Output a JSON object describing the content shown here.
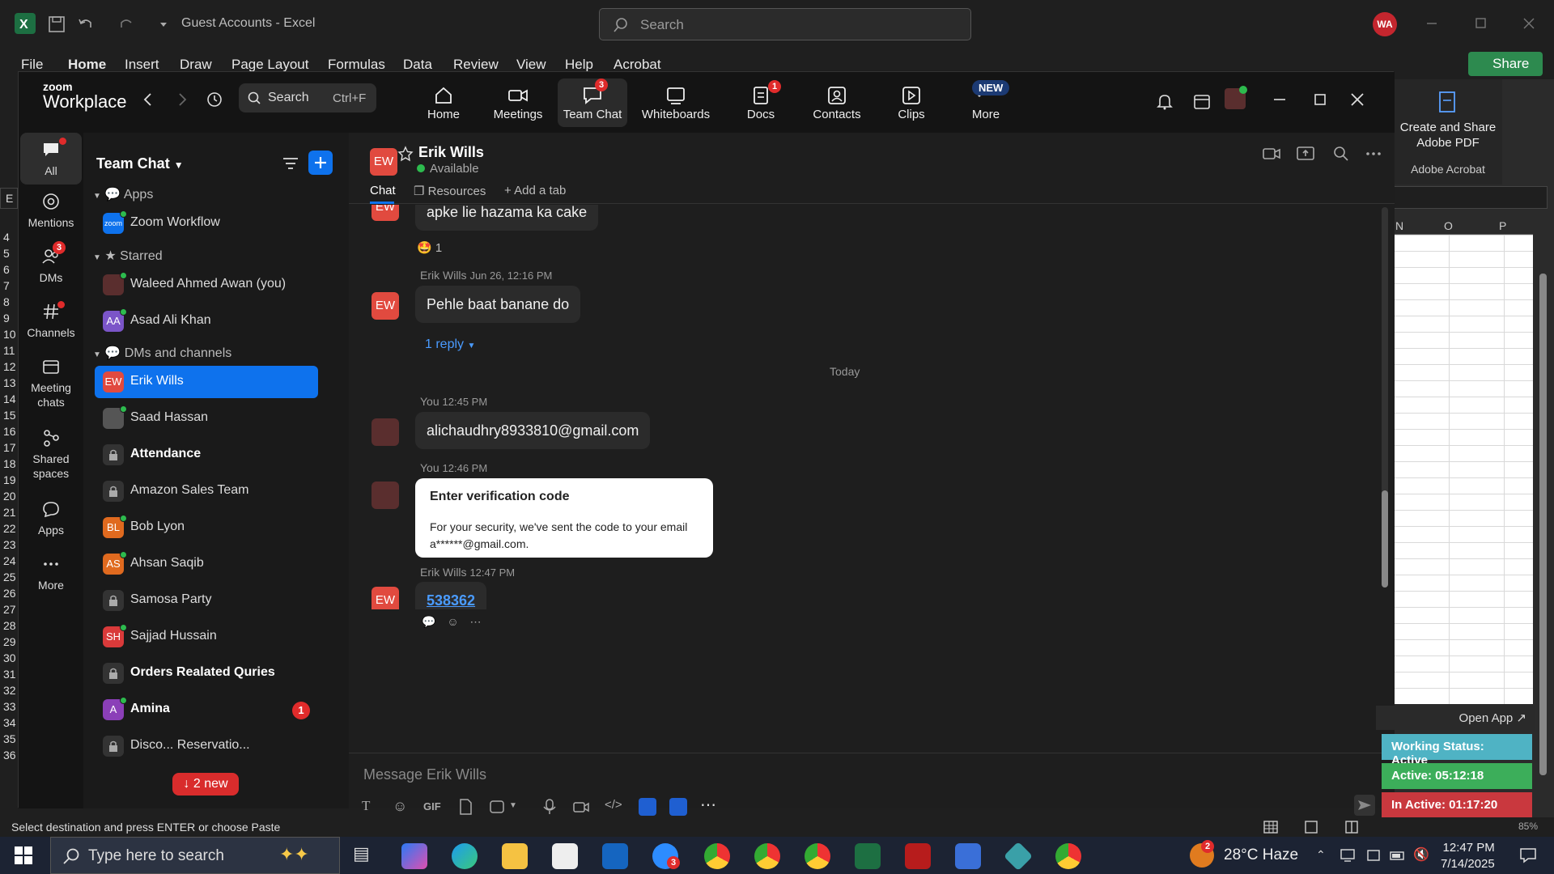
{
  "excel": {
    "title": "Guest Accounts  -  Excel",
    "search_placeholder": "Search",
    "avatar": "WA",
    "menu": [
      "File",
      "Home",
      "Insert",
      "Draw",
      "Page Layout",
      "Formulas",
      "Data",
      "Review",
      "View",
      "Help",
      "Acrobat"
    ],
    "share": "Share",
    "acrobat_label": "Create and Share Adobe PDF",
    "acrobat_group": "Adobe Acrobat",
    "columns": [
      "N",
      "O",
      "P"
    ],
    "rows": [
      "4",
      "5",
      "6",
      "7",
      "8",
      "9",
      "10",
      "11",
      "12",
      "13",
      "14",
      "15",
      "16",
      "17",
      "18",
      "19",
      "20",
      "21",
      "22",
      "23",
      "24",
      "25",
      "26",
      "27",
      "28",
      "29",
      "30",
      "31",
      "32",
      "33",
      "34",
      "35",
      "36"
    ],
    "name_box_letter": "E",
    "status_text": "Select destination and press ENTER or choose Paste",
    "zoom_level": "85%"
  },
  "zoom": {
    "logo_top": "zoom",
    "logo_bottom": "Workplace",
    "search_label": "Search",
    "search_shortcut": "Ctrl+F",
    "nav": [
      {
        "label": "Home",
        "icon": "home-icon"
      },
      {
        "label": "Meetings",
        "icon": "camera-icon"
      },
      {
        "label": "Team Chat",
        "icon": "chat-icon",
        "badge": "3"
      },
      {
        "label": "Whiteboards",
        "icon": "whiteboard-icon"
      },
      {
        "label": "Docs",
        "icon": "doc-icon",
        "badge": "1"
      },
      {
        "label": "Contacts",
        "icon": "contacts-icon"
      },
      {
        "label": "Clips",
        "icon": "clips-icon"
      },
      {
        "label": "More",
        "icon": "more-icon"
      }
    ],
    "new_badge": "NEW",
    "rail": [
      {
        "label": "All"
      },
      {
        "label": "Mentions"
      },
      {
        "label": "DMs",
        "badge": "3"
      },
      {
        "label": "Channels"
      },
      {
        "label": "Meeting chats"
      },
      {
        "label": "Shared spaces"
      },
      {
        "label": "Apps"
      },
      {
        "label": "More"
      }
    ],
    "sidebar": {
      "title": "Team Chat",
      "sec_apps": "Apps",
      "sec_starred": "Starred",
      "sec_dms": "DMs and channels",
      "items": [
        {
          "label": "Zoom Workflow",
          "avatar": "zoom"
        },
        {
          "label": "Waleed Ahmed Awan (you)"
        },
        {
          "label": "Asad Ali Khan",
          "avatar": "AA"
        },
        {
          "label": "Erik Wills",
          "avatar": "EW"
        },
        {
          "label": "Saad Hassan"
        },
        {
          "label": "Attendance"
        },
        {
          "label": "Amazon Sales Team"
        },
        {
          "label": "Bob Lyon",
          "avatar": "BL"
        },
        {
          "label": "Ahsan Saqib",
          "avatar": "AS"
        },
        {
          "label": "Samosa Party"
        },
        {
          "label": "Sajjad Hussain",
          "avatar": "SH"
        },
        {
          "label": "Orders Realated Quries"
        },
        {
          "label": "Amina",
          "avatar": "A",
          "badge": "1"
        },
        {
          "label": "Disco... Reservatio..."
        }
      ],
      "new_pill": "↓ 2 new"
    },
    "chat": {
      "contact_avatar": "EW",
      "contact_name": "Erik Wills",
      "contact_status": "Available",
      "tabs": [
        "Chat",
        "Resources",
        "+ Add a tab"
      ],
      "messages": [
        {
          "text": "apke lie hazama ka cake",
          "reaction": "🤩 1"
        },
        {
          "meta_name": "Erik Wills",
          "meta_time": "Jun 26, 12:16 PM",
          "text": "Pehle baat banane do",
          "reply": "1 reply"
        },
        {
          "divider": "Today"
        },
        {
          "meta_name": "You",
          "meta_time": "12:45 PM",
          "text": "alichaudhry8933810@gmail.com"
        },
        {
          "meta_name": "You",
          "meta_time": "12:46 PM",
          "card_title": "Enter verification code",
          "card_body": "For your security, we've sent the code to your email a******@gmail.com."
        },
        {
          "meta_name": "Erik Wills",
          "meta_time": "12:47 PM",
          "text": "538362"
        }
      ],
      "composer_placeholder": "Message Erik Wills",
      "toolbar_gif": "GIF"
    }
  },
  "widgets": {
    "open_app": "Open App ↗",
    "working_status": "Working Status: Active",
    "active": "Active: 05:12:18",
    "inactive": "In Active: 01:17:20"
  },
  "taskbar": {
    "search_placeholder": "Type here to search",
    "weather": "28°C  Haze",
    "weather_badge": "2",
    "time": "12:47 PM",
    "date": "7/14/2025",
    "zoom_badge": "3"
  },
  "colors": {
    "zoom_blue": "#0e72ed",
    "excel_green": "#2d8a4f",
    "ew_avatar": "#e14a3f"
  }
}
